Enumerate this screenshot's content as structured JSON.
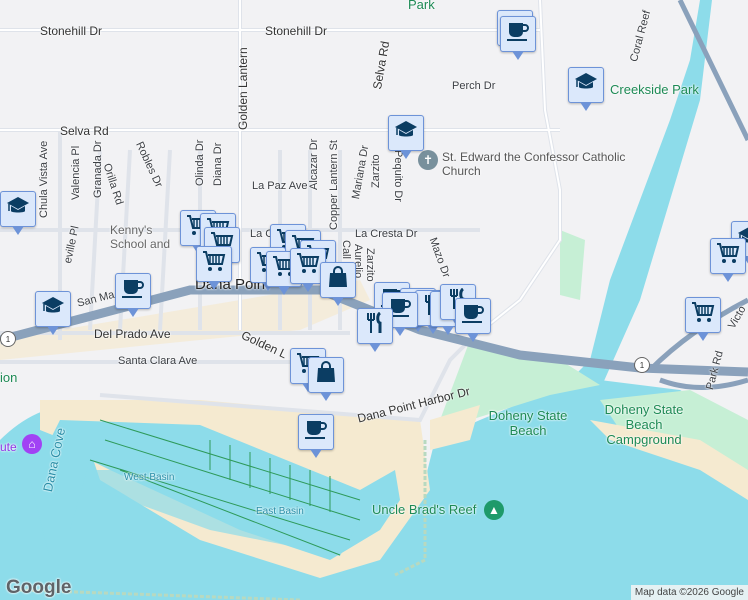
{
  "roads": {
    "stonehill": "Stonehill Dr",
    "stonehill2": "Stonehill Dr",
    "selva_rd": "Selva Rd",
    "selva_rd_v": "Selva Rd",
    "golden_lantern": "Golden Lantern",
    "perch": "Perch Dr",
    "la_paz": "La Paz Ave",
    "la_cresta": "La Cresta Dr",
    "la_c": "La C",
    "chula_vista": "Chula Vista Ave",
    "valencia": "Valencia Pl",
    "granada": "Granada Dr",
    "orilla": "Orilla Rd",
    "robles": "Robles Dr",
    "olinda": "Olinda Dr",
    "diana": "Diana Dr",
    "alcazar": "Alcazar Dr",
    "copper_lantern": "Copper Lantern St",
    "mariana": "Mariana Dr",
    "zarzito": "Zarzito",
    "zarzito2": "Zarzito",
    "pequito": "Pequito Dr",
    "mazo": "Mazo Dr",
    "calle": "Call",
    "aurelio": "Aurelio",
    "seville": "eville Pl",
    "san_ma": "San Ma",
    "del_prado": "Del Prado Ave",
    "santa_clara": "Santa Clara Ave",
    "golden_l2": "Golden L",
    "harbor_dr": "Dana Point Harbor Dr",
    "harbor_dr2": "Dana Point Harbor Dr",
    "coral_reef": "Coral Reef",
    "park_rd": "Park Rd",
    "victoria": "Victo",
    "hwy1": "1",
    "hwy1b": "1"
  },
  "places": {
    "park_top": "Park",
    "creekside": "Creekside Park",
    "church": "St. Edward the Confessor Catholic Church",
    "kennys": "Kenny's Music School and Store",
    "kennys_line1": "Kenny's",
    "kennys_line2": "School and",
    "dana_point": "Dana Point",
    "doheny_beach": "Doheny State Beach",
    "doheny_camp": "Doheny State Beach Campground",
    "dana_cove": "Dana Cove",
    "west_basin": "West Basin",
    "east_basin": "East Basin",
    "uncle_brads": "Uncle Brad's Reef",
    "ute": "ute",
    "ion": "ion"
  },
  "markers": [
    {
      "type": "coffee"
    },
    {
      "type": "coffee"
    },
    {
      "type": "school"
    },
    {
      "type": "school"
    },
    {
      "type": "school"
    },
    {
      "type": "school"
    },
    {
      "type": "cart"
    },
    {
      "type": "cart"
    },
    {
      "type": "cart"
    },
    {
      "type": "cart"
    },
    {
      "type": "cart"
    },
    {
      "type": "cart"
    },
    {
      "type": "cart"
    },
    {
      "type": "cart"
    },
    {
      "type": "cart"
    },
    {
      "type": "cart"
    },
    {
      "type": "bag"
    },
    {
      "type": "coffee"
    },
    {
      "type": "coffee"
    },
    {
      "type": "restaurant"
    },
    {
      "type": "restaurant"
    },
    {
      "type": "restaurant"
    },
    {
      "type": "restaurant"
    },
    {
      "type": "coffee"
    },
    {
      "type": "restaurant"
    },
    {
      "type": "coffee"
    },
    {
      "type": "cart"
    },
    {
      "type": "bag"
    },
    {
      "type": "coffee"
    },
    {
      "type": "school"
    },
    {
      "type": "cart"
    },
    {
      "type": "cart"
    }
  ],
  "attribution": {
    "logo": "Google",
    "map_data": "Map data ©2026 Google"
  },
  "colors": {
    "land": "#f2f2f4",
    "water": "#8ddcea",
    "park": "#c6efd5",
    "sand": "#f5ead0",
    "highway": "#8aa1bb",
    "marker_bg": "#dbe8fb",
    "marker_icon": "#0b3d63"
  }
}
